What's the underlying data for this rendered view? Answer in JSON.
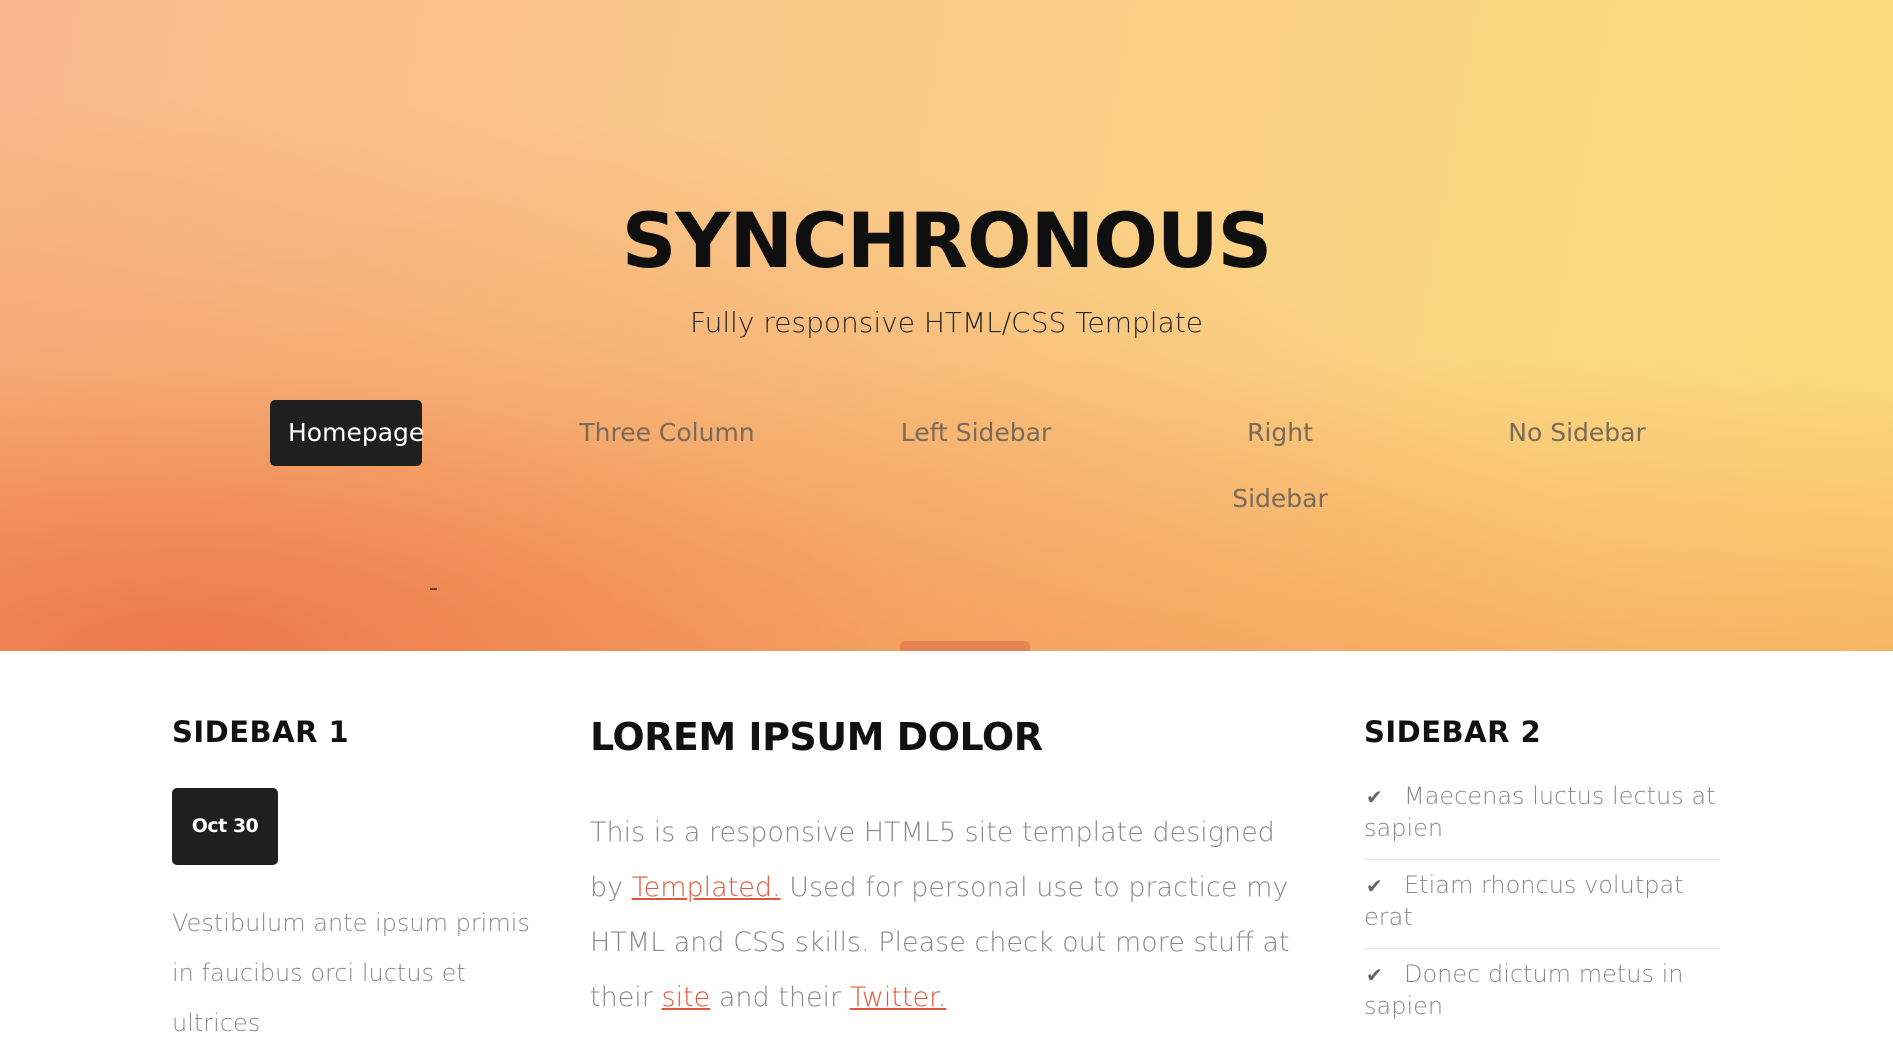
{
  "header": {
    "title": "SYNCHRONOUS",
    "subtitle": "Fully responsive HTML/CSS Template"
  },
  "nav": {
    "items": [
      {
        "label": "Homepage",
        "active": true
      },
      {
        "label": "Three Column"
      },
      {
        "label": "Left Sidebar"
      },
      {
        "label": "Right Sidebar"
      },
      {
        "label": "No Sidebar"
      }
    ]
  },
  "sidebar1": {
    "heading": "SIDEBAR 1",
    "date": "Oct 30",
    "text": "Vestibulum ante ipsum primis in faucibus orci luctus et ultrices"
  },
  "main": {
    "heading": "LOREM IPSUM DOLOR",
    "text_1": "This is a responsive HTML5 site template designed by ",
    "link_templated": "Templated.",
    "text_2": " Used for personal use to practice my HTML and CSS skills. Please check out more stuff at their ",
    "link_site": "site",
    "text_3": " and their ",
    "link_twitter": "Twitter."
  },
  "sidebar2": {
    "heading": "SIDEBAR 2",
    "items": [
      "Maecenas luctus lectus at sapien",
      "Etiam rhoncus volutpat erat",
      "Donec dictum metus in sapien"
    ]
  },
  "colors": {
    "accent_link": "#e2563a",
    "nav_active_bg": "#1f1f1f",
    "hero_start": "#f8b98c",
    "hero_end": "#fbdc7c"
  },
  "icons": {
    "list_check": "check-icon"
  }
}
